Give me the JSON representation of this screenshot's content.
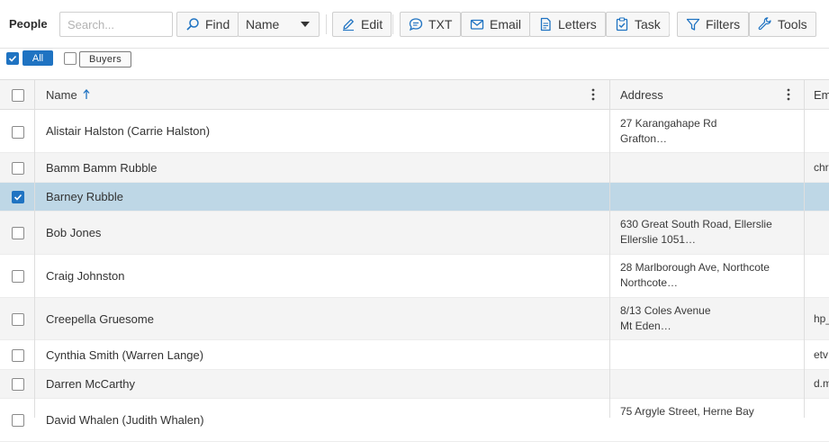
{
  "toolbar": {
    "title": "People",
    "search_placeholder": "Search...",
    "find_label": "Find",
    "field_select_value": "Name",
    "edit_label": "Edit",
    "txt_label": "TXT",
    "email_label": "Email",
    "letters_label": "Letters",
    "task_label": "Task",
    "filters_label": "Filters",
    "tools_label": "Tools"
  },
  "filters": {
    "all_label": "All",
    "all_checked": true,
    "buyers_label": "Buyers",
    "buyers_checked": false
  },
  "grid": {
    "columns": {
      "name": "Name",
      "address": "Address",
      "email": "Em"
    },
    "sort": "name ascending",
    "rows": [
      {
        "name": "Alistair Halston (Carrie Halston)",
        "address1": "27 Karangahape Rd",
        "address2": "Grafton…",
        "email": "",
        "checked": false
      },
      {
        "name": "Bamm Bamm Rubble",
        "address1": "",
        "address2": "",
        "email": "chr",
        "checked": false
      },
      {
        "name": "Barney Rubble",
        "address1": "",
        "address2": "",
        "email": "",
        "checked": true
      },
      {
        "name": "Bob Jones",
        "address1": "630 Great South Road, Ellerslie",
        "address2": "Ellerslie 1051…",
        "email": "",
        "checked": false
      },
      {
        "name": "Craig Johnston",
        "address1": "28 Marlborough Ave, Northcote",
        "address2": "Northcote…",
        "email": "",
        "checked": false
      },
      {
        "name": "Creepella Gruesome",
        "address1": "8/13 Coles Avenue",
        "address2": "Mt Eden…",
        "email": "hp_",
        "checked": false
      },
      {
        "name": "Cynthia Smith (Warren Lange)",
        "address1": "",
        "address2": "",
        "email": "etv",
        "checked": false
      },
      {
        "name": "Darren McCarthy",
        "address1": "",
        "address2": "",
        "email": "d.m",
        "checked": false
      },
      {
        "name": "David Whalen (Judith Whalen)",
        "address1": "75 Argyle Street, Herne Bay",
        "address2": "",
        "email": "",
        "checked": false
      }
    ]
  },
  "colors": {
    "accent": "#1f73c2",
    "selected_row": "#bed7e6",
    "alt_row": "#f4f4f4"
  }
}
